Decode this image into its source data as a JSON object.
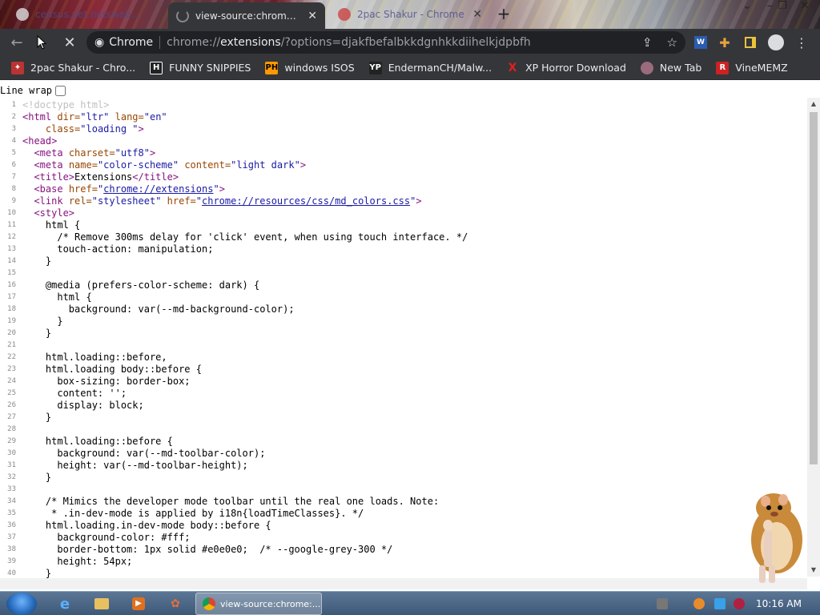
{
  "tabs": [
    {
      "label": "census.net.netsweb...",
      "active": false
    },
    {
      "label": "view-source:chrome://ext",
      "active": true
    },
    {
      "label": "2pac Shakur - Chrome",
      "active": false
    }
  ],
  "toolbar": {
    "site_chip": "Chrome",
    "url_scheme": "chrome://",
    "url_host": "extensions",
    "url_path": "/?options=djakfbefalbkkdgnhkkdiihelkjdpbfh"
  },
  "bookmarks": [
    {
      "label": "2pac Shakur - Chro...",
      "icon": "T",
      "color": "#b33"
    },
    {
      "label": "FUNNY SNIPPIES",
      "icon": "H",
      "color": "#222"
    },
    {
      "label": "windows ISOS",
      "icon": "PH",
      "color": "#f90"
    },
    {
      "label": "EndermanCH/Malw...",
      "icon": "YP",
      "color": "#222"
    },
    {
      "label": "XP Horror Download",
      "icon": "X",
      "color": "#c00"
    },
    {
      "label": "New Tab",
      "icon": "●",
      "color": "#888"
    },
    {
      "label": "VineMEMZ",
      "icon": "R",
      "color": "#c22"
    }
  ],
  "page": {
    "linewrap_label": "Line wrap"
  },
  "source_lines": [
    [
      {
        "t": "<!doctype html>",
        "c": "doctype"
      }
    ],
    [
      {
        "t": "<html ",
        "c": "tag"
      },
      {
        "t": "dir=",
        "c": "attr"
      },
      {
        "t": "\"ltr\" ",
        "c": "val"
      },
      {
        "t": "lang=",
        "c": "attr"
      },
      {
        "t": "\"en\"",
        "c": "val"
      }
    ],
    [
      {
        "t": "    ",
        "c": "code"
      },
      {
        "t": "class=",
        "c": "attr"
      },
      {
        "t": "\"loading \"",
        "c": "val"
      },
      {
        "t": ">",
        "c": "tag"
      }
    ],
    [
      {
        "t": "<head>",
        "c": "tag"
      }
    ],
    [
      {
        "t": "  ",
        "c": "code"
      },
      {
        "t": "<meta ",
        "c": "tag"
      },
      {
        "t": "charset=",
        "c": "attr"
      },
      {
        "t": "\"utf8\"",
        "c": "val"
      },
      {
        "t": ">",
        "c": "tag"
      }
    ],
    [
      {
        "t": "  ",
        "c": "code"
      },
      {
        "t": "<meta ",
        "c": "tag"
      },
      {
        "t": "name=",
        "c": "attr"
      },
      {
        "t": "\"color-scheme\" ",
        "c": "val"
      },
      {
        "t": "content=",
        "c": "attr"
      },
      {
        "t": "\"light dark\"",
        "c": "val"
      },
      {
        "t": ">",
        "c": "tag"
      }
    ],
    [
      {
        "t": "  ",
        "c": "code"
      },
      {
        "t": "<title>",
        "c": "tag"
      },
      {
        "t": "Extensions",
        "c": "code"
      },
      {
        "t": "</title>",
        "c": "tag"
      }
    ],
    [
      {
        "t": "  ",
        "c": "code"
      },
      {
        "t": "<base ",
        "c": "tag"
      },
      {
        "t": "href=",
        "c": "attr"
      },
      {
        "t": "\"",
        "c": "val"
      },
      {
        "t": "chrome://extensions",
        "c": "lnk"
      },
      {
        "t": "\"",
        "c": "val"
      },
      {
        "t": ">",
        "c": "tag"
      }
    ],
    [
      {
        "t": "  ",
        "c": "code"
      },
      {
        "t": "<link ",
        "c": "tag"
      },
      {
        "t": "rel=",
        "c": "attr"
      },
      {
        "t": "\"stylesheet\" ",
        "c": "val"
      },
      {
        "t": "href=",
        "c": "attr"
      },
      {
        "t": "\"",
        "c": "val"
      },
      {
        "t": "chrome://resources/css/md_colors.css",
        "c": "lnk"
      },
      {
        "t": "\"",
        "c": "val"
      },
      {
        "t": ">",
        "c": "tag"
      }
    ],
    [
      {
        "t": "  ",
        "c": "code"
      },
      {
        "t": "<style>",
        "c": "tag"
      }
    ],
    [
      {
        "t": "    html {",
        "c": "code"
      }
    ],
    [
      {
        "t": "      /* Remove 300ms delay for 'click' event, when using touch interface. */",
        "c": "code"
      }
    ],
    [
      {
        "t": "      touch-action: manipulation;",
        "c": "code"
      }
    ],
    [
      {
        "t": "    }",
        "c": "code"
      }
    ],
    [
      {
        "t": "",
        "c": "code"
      }
    ],
    [
      {
        "t": "    @media (prefers-color-scheme: dark) {",
        "c": "code"
      }
    ],
    [
      {
        "t": "      html {",
        "c": "code"
      }
    ],
    [
      {
        "t": "        background: var(--md-background-color);",
        "c": "code"
      }
    ],
    [
      {
        "t": "      }",
        "c": "code"
      }
    ],
    [
      {
        "t": "    }",
        "c": "code"
      }
    ],
    [
      {
        "t": "",
        "c": "code"
      }
    ],
    [
      {
        "t": "    html.loading::before,",
        "c": "code"
      }
    ],
    [
      {
        "t": "    html.loading body::before {",
        "c": "code"
      }
    ],
    [
      {
        "t": "      box-sizing: border-box;",
        "c": "code"
      }
    ],
    [
      {
        "t": "      content: '';",
        "c": "code"
      }
    ],
    [
      {
        "t": "      display: block;",
        "c": "code"
      }
    ],
    [
      {
        "t": "    }",
        "c": "code"
      }
    ],
    [
      {
        "t": "",
        "c": "code"
      }
    ],
    [
      {
        "t": "    html.loading::before {",
        "c": "code"
      }
    ],
    [
      {
        "t": "      background: var(--md-toolbar-color);",
        "c": "code"
      }
    ],
    [
      {
        "t": "      height: var(--md-toolbar-height);",
        "c": "code"
      }
    ],
    [
      {
        "t": "    }",
        "c": "code"
      }
    ],
    [
      {
        "t": "",
        "c": "code"
      }
    ],
    [
      {
        "t": "    /* Mimics the developer mode toolbar until the real one loads. Note:",
        "c": "code"
      }
    ],
    [
      {
        "t": "     * .in-dev-mode is applied by i18n{loadTimeClasses}. */",
        "c": "code"
      }
    ],
    [
      {
        "t": "    html.loading.in-dev-mode body::before {",
        "c": "code"
      }
    ],
    [
      {
        "t": "      background-color: #fff;",
        "c": "code"
      }
    ],
    [
      {
        "t": "      border-bottom: 1px solid #e0e0e0;  /* --google-grey-300 */",
        "c": "code"
      }
    ],
    [
      {
        "t": "      height: 54px;",
        "c": "code"
      }
    ],
    [
      {
        "t": "    }",
        "c": "code"
      }
    ]
  ],
  "taskbar": {
    "task_label": "view-source:chrome:...",
    "clock": "10:16 AM"
  }
}
